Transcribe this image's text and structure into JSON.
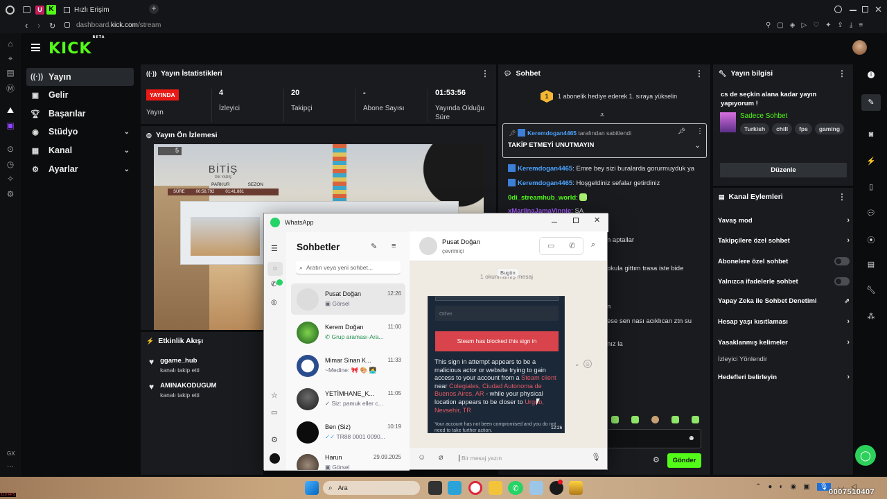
{
  "browser": {
    "tab_title": "Hızlı Erişim",
    "url_domain": "dashboard.",
    "url_host": "kick.com",
    "url_path": "/stream",
    "fps": "119 FPS",
    "gx_label": "GX"
  },
  "kick": {
    "logo": "KICK",
    "logo_badge": "BETA",
    "nav": [
      {
        "label": "Yayın",
        "icon": "broadcast-icon"
      },
      {
        "label": "Gelir",
        "icon": "money-icon"
      },
      {
        "label": "Başarılar",
        "icon": "trophy-icon"
      },
      {
        "label": "Stüdyo",
        "icon": "camera-icon"
      },
      {
        "label": "Kanal",
        "icon": "grid-icon"
      },
      {
        "label": "Ayarlar",
        "icon": "settings-icon"
      }
    ]
  },
  "stats": {
    "title": "Yayın İstatistikleri",
    "live_badge": "YAYINDA",
    "live_label": "Yayın",
    "items": [
      {
        "value": "4",
        "label": "İzleyici"
      },
      {
        "value": "20",
        "label": "Takipçi"
      },
      {
        "value": "-",
        "label": "Abone Sayısı"
      },
      {
        "value": "01:53:56",
        "label": "Yayında Olduğu Süre"
      }
    ]
  },
  "preview": {
    "title": "Yayın Ön İzlemesi",
    "game_text": "BİTİŞ",
    "game_sub": "DİK YARIŞ",
    "game_cols": [
      "PARKUR",
      "SEZON"
    ],
    "game_rows": [
      [
        "SÜRE",
        "00:58.792",
        "01:41.881"
      ]
    ],
    "game_count": "5"
  },
  "activity": {
    "title": "Etkinlik Akışı",
    "items": [
      {
        "name": "ggame_hub",
        "action": "kanalı takip etti"
      },
      {
        "name": "AMINAKODUGUM",
        "action": "kanalı takip etti"
      }
    ]
  },
  "chat": {
    "title": "Sohbet",
    "gift_badge": "1",
    "gift_text": "1 abonelik hediye ederek 1. sıraya yükselin",
    "pinned_user": "Keremdogan4465",
    "pinned_by": "tarafından sabitlendi",
    "pinned_text": "TAKİP ETMEYİ UNUTMAYIN",
    "messages": [
      {
        "user": "Keremdogan4465",
        "text": ": Emre bey sizi buralarda gorurmuyduk ya"
      },
      {
        "user": "Keremdogan4465",
        "text": ": Hoşgeldiniz sefalar getirdiniz"
      },
      {
        "user": "0di_streamhub_world",
        "text": ":"
      },
      {
        "user": "xMarilnaJamaVinnie",
        "text": ": SA"
      }
    ],
    "partial": [
      "n aptallar",
      "okula gittım trasa iste bide",
      "n",
      "ese sen nası acıklıcan ztn su",
      "nız la"
    ],
    "send_label": "Gönder"
  },
  "stream_info": {
    "title": "Yayın bilgisi",
    "stream_title": "cs de seçkin alana kadar yayın yapıyorum !",
    "category": "Sadece Sohbet",
    "tags": [
      "Turkish",
      "chill",
      "fps",
      "gaming"
    ],
    "edit_label": "Düzenle"
  },
  "channel_actions": {
    "title": "Kanal Eylemleri",
    "items": [
      {
        "label": "Yavaş mod",
        "control": "chevron"
      },
      {
        "label": "Takipçilere özel sohbet",
        "control": "chevron"
      },
      {
        "label": "Abonelere özel sohbet",
        "control": "toggle"
      },
      {
        "label": "Yalnızca ifadelerle sohbet",
        "control": "toggle"
      },
      {
        "label": "Yapay Zeka ile Sohbet Denetimi",
        "control": "external"
      },
      {
        "label": "Hesap yaşı kısıtlaması",
        "control": "chevron"
      },
      {
        "label": "Yasaklanmış kelimeler",
        "control": "chevron"
      },
      {
        "label": "İzleyici Yönlendir",
        "control": "none"
      },
      {
        "label": "Hedefleri belirleyin",
        "control": "chevron"
      }
    ]
  },
  "whatsapp": {
    "app_title": "WhatsApp",
    "chats_title": "Sohbetler",
    "search_placeholder": "Aratın veya yeni sohbet...",
    "chats": [
      {
        "name": "Pusat Doğan",
        "time": "12:26",
        "preview": "Görsel"
      },
      {
        "name": "Kerem Doğan",
        "time": "11:00",
        "preview": "Grup araması·Ara..."
      },
      {
        "name": "Mimar Sinan K...",
        "time": "11:33",
        "preview": "~Medine: 🎀 🎨 👩‍💻"
      },
      {
        "name": "YETİMHANE_K...",
        "time": "11:05",
        "preview": "Siz: pamuk eller c..."
      },
      {
        "name": "Ben (Siz)",
        "time": "10:19",
        "preview": "TR88 0001 0090..."
      },
      {
        "name": "Harun",
        "time": "29.09.2025",
        "preview": "Görsel"
      }
    ],
    "contact_name": "Pusat Doğan",
    "contact_status": "çevrimiçi",
    "date_chip": "Bugün",
    "unread_hint": "1 okunmamış mesaj",
    "steam_other": "Other",
    "steam_blocked": "Steam has blocked this sign in",
    "steam_body_1": "This sign in attempt appears to be a malicious actor or website trying to gain access to your account from a",
    "steam_link_1": "Steam client",
    "steam_body_2": "near",
    "steam_link_2": "Colegiales, Ciudad Autonoma de Buenos Aires, AR",
    "steam_body_3": "- while your physical location appears to be closer to",
    "steam_link_3": "Urgub, Nevsehir, TR",
    "steam_footer": "Your account has not been compromised and you do not need to take further action.",
    "msg_time": "12:26",
    "input_placeholder": "Bir mesaj yazın"
  },
  "taskbar": {
    "search_label": "Ara",
    "time_text": "0007510407"
  }
}
